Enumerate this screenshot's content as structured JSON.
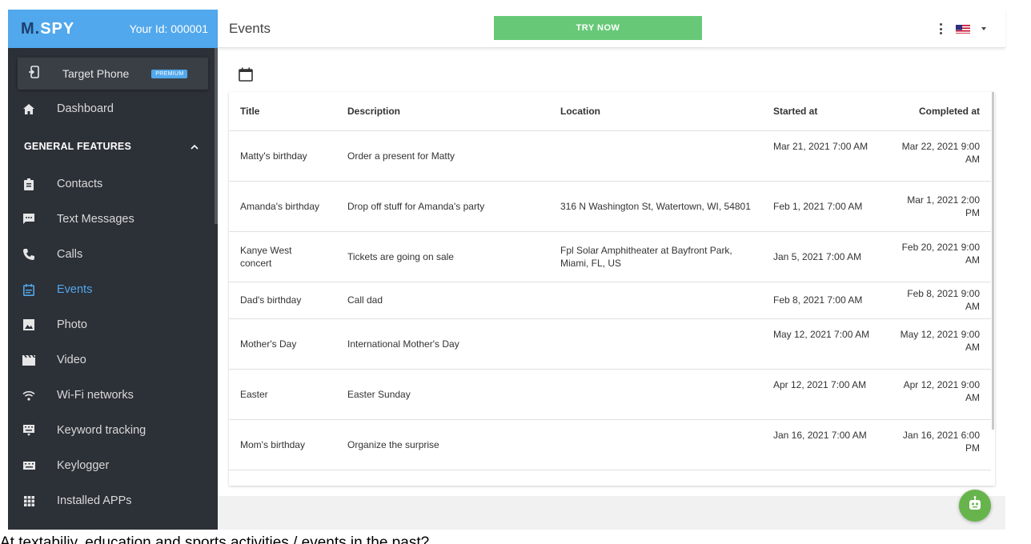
{
  "brand": {
    "logo_text": "M.SPY",
    "your_id": "Your Id: 000001",
    "accent": "#52a8ec",
    "sidebar_bg": "#2c3037"
  },
  "target": {
    "label": "Target Phone",
    "badge": "PREMIUM"
  },
  "sidebar": {
    "dashboard": "Dashboard",
    "section_label": "GENERAL FEATURES",
    "items": [
      {
        "label": "Contacts",
        "icon": "contacts-icon"
      },
      {
        "label": "Text Messages",
        "icon": "message-icon"
      },
      {
        "label": "Calls",
        "icon": "phone-icon"
      },
      {
        "label": "Events",
        "icon": "calendar-icon",
        "active": true
      },
      {
        "label": "Photo",
        "icon": "image-icon"
      },
      {
        "label": "Video",
        "icon": "video-icon"
      },
      {
        "label": "Wi-Fi networks",
        "icon": "wifi-icon"
      },
      {
        "label": "Keyword tracking",
        "icon": "keyboard-icon"
      },
      {
        "label": "Keylogger",
        "icon": "keyboard-icon"
      },
      {
        "label": "Installed APPs",
        "icon": "apps-grid-icon"
      }
    ]
  },
  "header": {
    "title": "Events",
    "try_now": "TRY NOW",
    "try_now_color": "#67c978"
  },
  "table": {
    "columns": [
      "Title",
      "Description",
      "Location",
      "Started at",
      "Completed at"
    ],
    "rows": [
      {
        "title": "Matty's birthday",
        "description": "Order a present for Matty",
        "location": "",
        "started": "Mar 21, 2021 7:00 AM",
        "completed": "Mar 22, 2021 9:00 AM"
      },
      {
        "title": "Amanda's birthday",
        "description": "Drop off stuff for Amanda's party",
        "location": "316 N Washington St, Watertown, WI, 54801",
        "started": "Feb 1, 2021 7:00 AM",
        "completed": "Mar 1, 2021 2:00 PM"
      },
      {
        "title": "Kanye West concert",
        "description": "Tickets are going on sale",
        "location": "Fpl Solar Amphitheater at Bayfront Park, Miami, FL, US",
        "started": "Jan 5, 2021 7:00 AM",
        "completed": "Feb 20, 2021 9:00 AM"
      },
      {
        "title": "Dad's birthday",
        "description": "Call dad",
        "location": "",
        "started": "Feb 8, 2021 7:00 AM",
        "completed": "Feb 8, 2021 9:00 AM"
      },
      {
        "title": "Mother's Day",
        "description": "International Mother's Day",
        "location": "",
        "started": "May 12, 2021 7:00 AM",
        "completed": "May 12, 2021 9:00 AM"
      },
      {
        "title": "Easter",
        "description": "Easter Sunday",
        "location": "",
        "started": "Apr 12, 2021 7:00 AM",
        "completed": "Apr 12, 2021 9:00 AM"
      },
      {
        "title": "Mom's birthday",
        "description": "Organize the surprise",
        "location": "",
        "started": "Jan 16, 2021 7:00 AM",
        "completed": "Jan 16, 2021 6:00 PM"
      }
    ]
  },
  "caption": "At textabiliy, education and sports activities / events in the past?"
}
